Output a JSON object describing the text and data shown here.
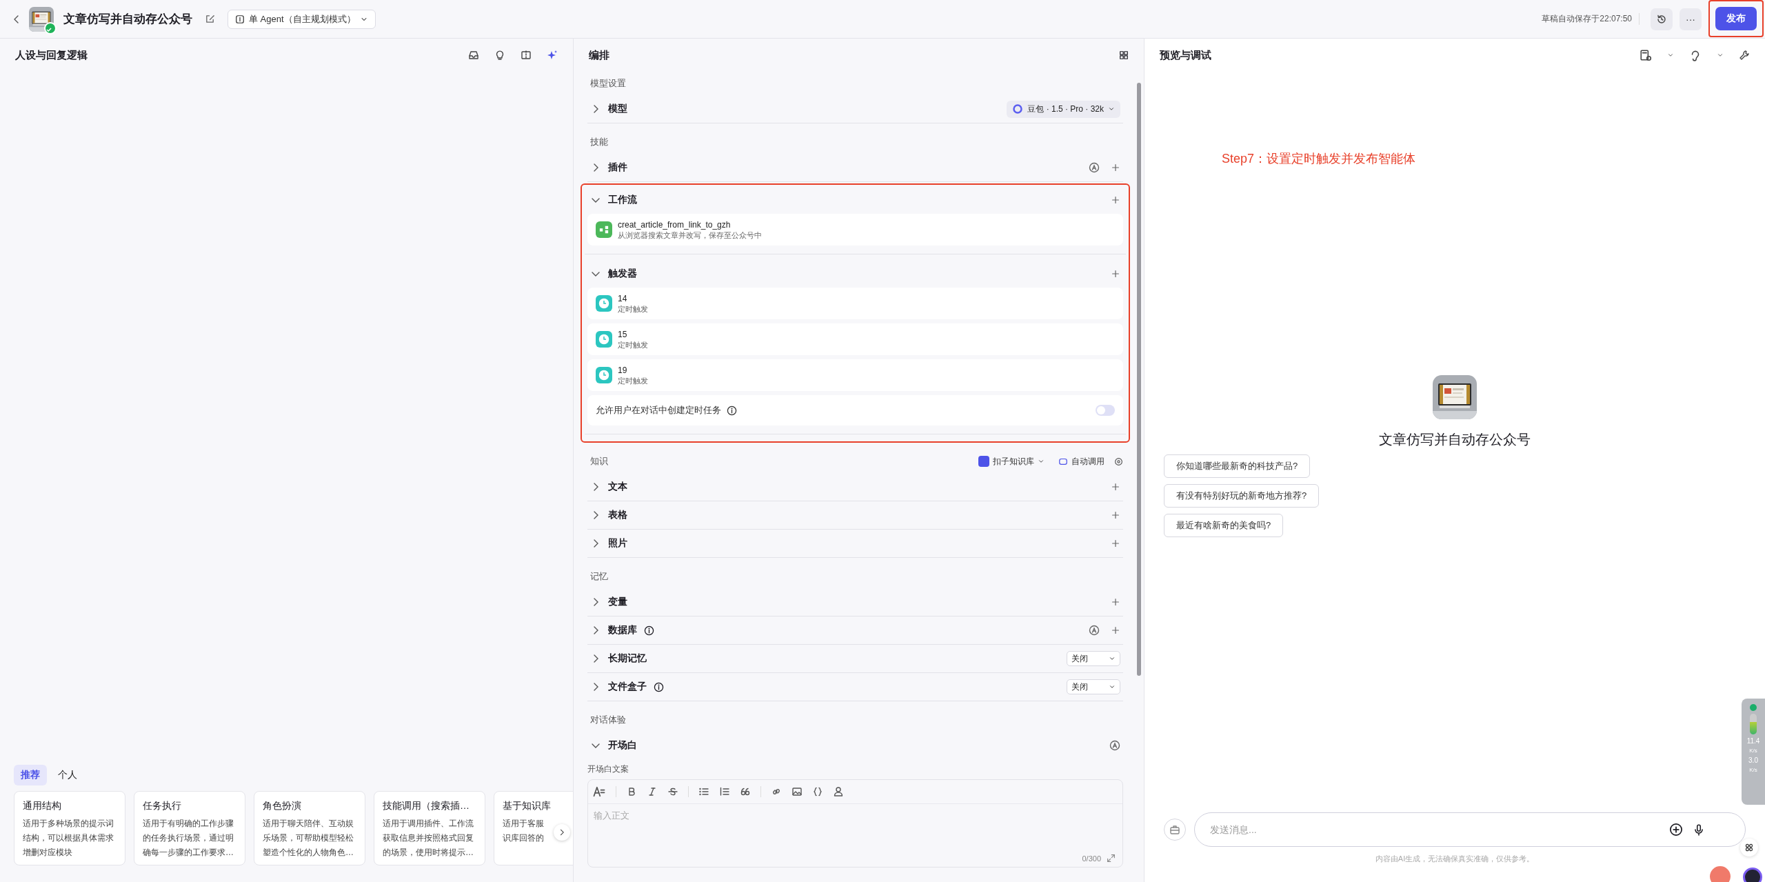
{
  "header": {
    "title": "文章仿写并自动存公众号",
    "mode": "单 Agent（自主规划模式）",
    "save_status": "草稿自动保存于22:07:50",
    "more": "···",
    "publish": {
      "label": "发布",
      "highlighted": true
    }
  },
  "persona": {
    "title": "人设与回复逻辑",
    "tabs": [
      {
        "label": "推荐",
        "selected": true
      },
      {
        "label": "个人",
        "selected": false
      }
    ],
    "templates": [
      {
        "title": "通用结构",
        "lines": [
          "适用于多种场景的提示词",
          "结构，可以根据具体需求",
          "增删对应模块"
        ]
      },
      {
        "title": "任务执行",
        "lines": [
          "适用于有明确的工作步骤",
          "的任务执行场景，通过明",
          "确每一步骤的工作要求…"
        ]
      },
      {
        "title": "角色扮演",
        "lines": [
          "适用于聊天陪伴、互动娱",
          "乐场景，可帮助模型轻松",
          "塑造个性化的人物角色…"
        ]
      },
      {
        "title": "技能调用（搜索插…",
        "lines": [
          "适用于调用插件、工作流",
          "获取信息并按照格式回复",
          "的场景，使用时将提示…"
        ]
      },
      {
        "title": "基于知识库",
        "lines": [
          "适用于客服",
          "识库回答的"
        ]
      }
    ]
  },
  "arrange": {
    "title": "编排",
    "sections": [
      {
        "heading": "模型设置",
        "rows": [
          {
            "kind": "model",
            "label": "模型",
            "expanded": false,
            "model": "豆包 · 1.5 · Pro · 32k"
          }
        ]
      },
      {
        "heading": "技能",
        "rows": [
          {
            "kind": "group",
            "label": "插件",
            "expanded": false,
            "auto": true,
            "addable": true,
            "highlighted": false
          },
          {
            "kind": "group",
            "label": "工作流",
            "expanded": true,
            "addable": true,
            "highlighted": true,
            "entries": [
              {
                "kind": "workflow",
                "name": "creat_article_from_link_to_gzh",
                "description": "从浏览器搜索文章并改写，保存至公众号中"
              }
            ]
          },
          {
            "kind": "group",
            "label": "触发器",
            "expanded": true,
            "addable": true,
            "highlighted": true,
            "entries": [
              {
                "kind": "trigger",
                "name": "14",
                "description": "定时触发"
              },
              {
                "kind": "trigger",
                "name": "15",
                "description": "定时触发"
              },
              {
                "kind": "trigger",
                "name": "19",
                "description": "定时触发"
              }
            ],
            "toggle": {
              "label": "允许用户在对话中创建定时任务",
              "on": false
            }
          }
        ]
      },
      {
        "heading": "知识",
        "source": "扣子知识库",
        "call_mode": "自动调用",
        "rows": [
          {
            "kind": "group",
            "label": "文本",
            "expanded": false,
            "addable": true
          },
          {
            "kind": "group",
            "label": "表格",
            "expanded": false,
            "addable": true
          },
          {
            "kind": "group",
            "label": "照片",
            "expanded": false,
            "addable": true
          }
        ]
      },
      {
        "heading": "记忆",
        "rows": [
          {
            "kind": "group",
            "label": "变量",
            "expanded": false,
            "addable": true
          },
          {
            "kind": "group",
            "label": "数据库",
            "expanded": false,
            "info": true,
            "auto": true,
            "addable": true
          },
          {
            "kind": "select",
            "label": "长期记忆",
            "expanded": false,
            "value": "关闭"
          },
          {
            "kind": "select",
            "label": "文件盒子",
            "expanded": false,
            "info": true,
            "value": "关闭"
          }
        ]
      },
      {
        "heading": "对话体验",
        "rows": [
          {
            "kind": "opening",
            "label": "开场白",
            "expanded": true,
            "auto": true,
            "field_label": "开场白文案",
            "placeholder": "输入正文",
            "counter": "0/300"
          }
        ]
      }
    ]
  },
  "preview": {
    "title": "预览与调试",
    "annotation": "Step7：设置定时触发并发布智能体",
    "bot_name": "文章仿写并自动存公众号",
    "suggestions": [
      "你知道哪些最新奇的科技产品?",
      "有没有特别好玩的新奇地方推荐?",
      "最近有啥新奇的美食吗?"
    ],
    "input_placeholder": "发送消息...",
    "disclaimer": "内容由AI生成，无法确保真实准确，仅供参考。"
  },
  "monitor": {
    "upload": "11.4",
    "upload_unit": "K/s",
    "download": "3.0",
    "download_unit": "K/s"
  }
}
